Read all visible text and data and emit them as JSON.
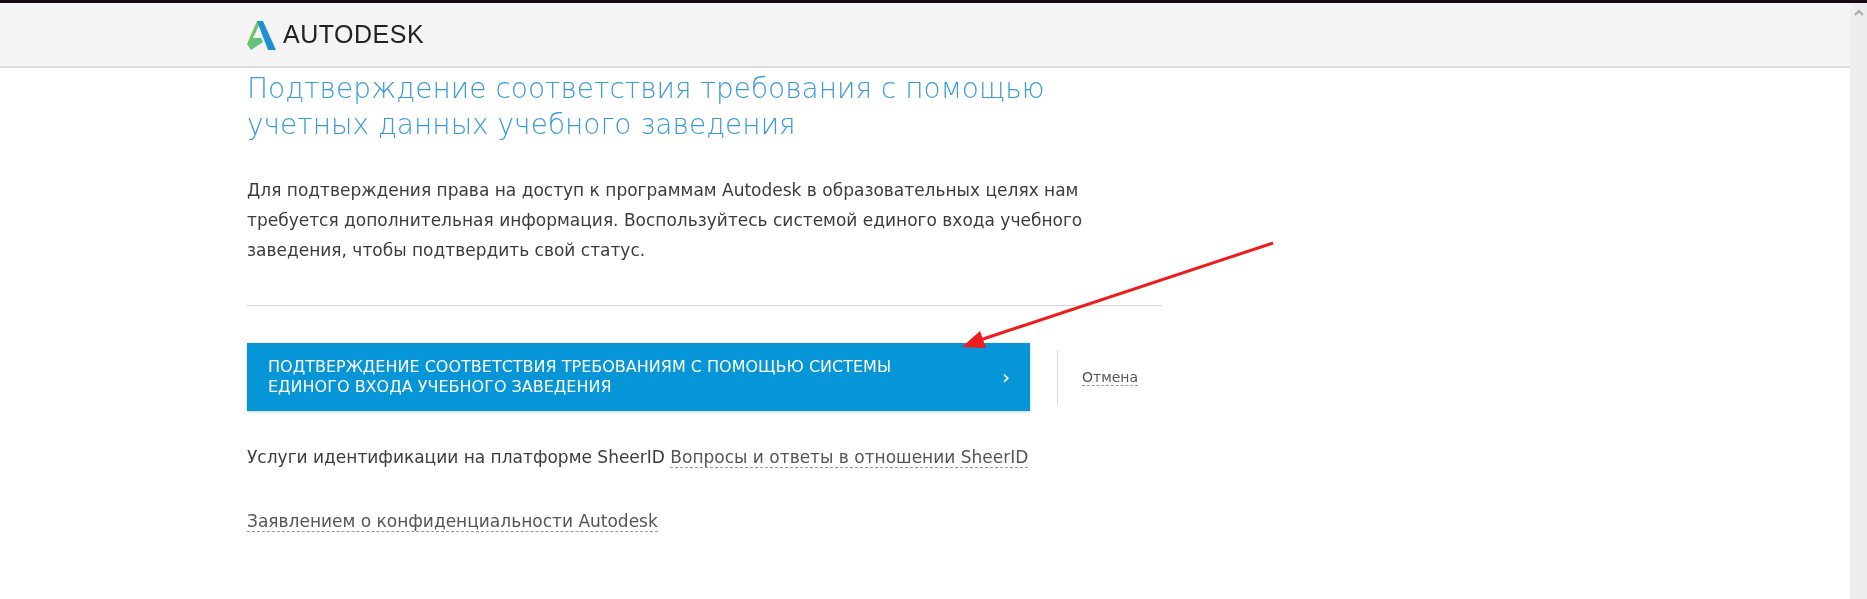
{
  "header": {
    "logo_text": "AUTODESK"
  },
  "title": "Подтверждение соответствия требования с помощью учетных данных учебного заведения",
  "intro": "Для подтверждения права на доступ к программам Autodesk в образовательных целях нам требуется дополнительная информация. Воспользуйтесь системой единого входа учебного заведения, чтобы подтвердить свой статус.",
  "primary_button": {
    "label": "ПОДТВЕРЖДЕНИЕ СООТВЕТСТВИЯ ТРЕБОВАНИЯМ С ПОМОЩЬЮ СИСТЕМЫ ЕДИНОГО ВХОДА УЧЕБНОГО ЗАВЕДЕНИЯ",
    "chevron": "›"
  },
  "cancel_link": "Отмена",
  "sheerid": {
    "text": "Услуги идентификации на платформе SheerID",
    "link": "Вопросы и ответы в отношении SheerID"
  },
  "privacy_link": "Заявлением о конфиденциальности Autodesk"
}
